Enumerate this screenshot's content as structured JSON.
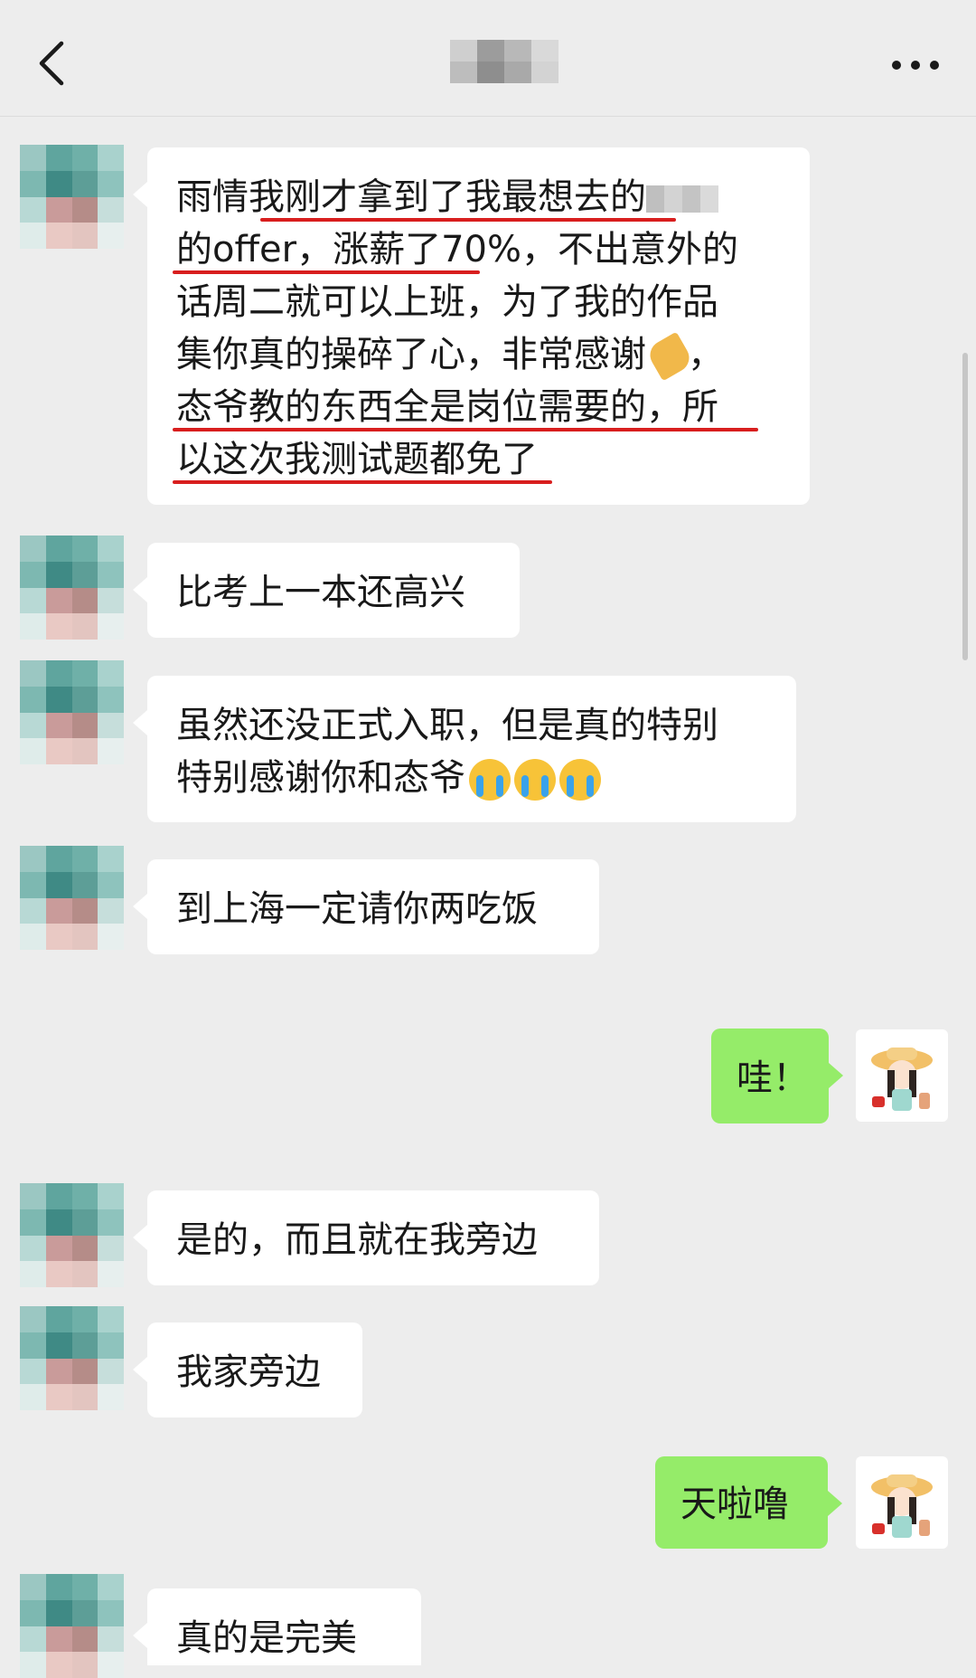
{
  "header": {
    "back_icon": "chevron-left-icon",
    "title_blurred": true,
    "more_icon": "more-horizontal-icon"
  },
  "messages": [
    {
      "from": "contact",
      "lines": [
        "雨情我刚才拿到了我最想去的",
        "的offer，涨薪了70%，不出意外的",
        "话周二就可以上班，为了我的作品",
        "集你真的操碎了心，非常感谢",
        "态爷教的东西全是岗位需要的，所",
        "以这次我测试题都免了"
      ],
      "trailing_punct": "，"
    },
    {
      "from": "contact",
      "text": "比考上一本还高兴"
    },
    {
      "from": "contact",
      "lines": [
        "虽然还没正式入职，但是真的特别",
        "特别感谢你和态爷"
      ]
    },
    {
      "from": "contact",
      "text": "到上海一定请你两吃饭"
    },
    {
      "from": "me",
      "text": "哇！"
    },
    {
      "from": "contact",
      "text": "是的，而且就在我旁边"
    },
    {
      "from": "contact",
      "text": "我家旁边"
    },
    {
      "from": "me",
      "text": "天啦噜"
    },
    {
      "from": "contact",
      "text": "真的是完美"
    }
  ],
  "colors": {
    "background": "#ededed",
    "incoming_bubble": "#ffffff",
    "outgoing_bubble": "#95ec69",
    "underline": "#d81e1e"
  }
}
